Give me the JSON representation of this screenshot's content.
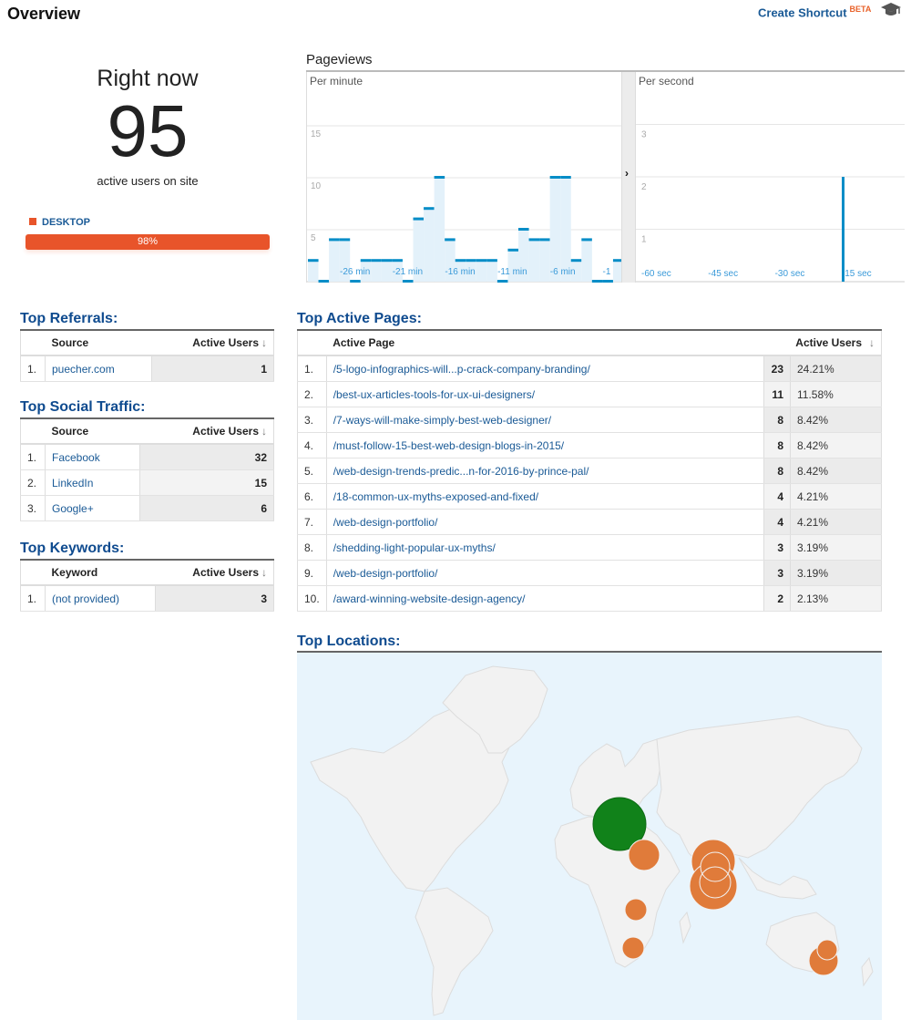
{
  "header": {
    "title": "Overview",
    "shortcut_label": "Create Shortcut",
    "shortcut_badge": "BETA",
    "help_icon": "graduation-cap-icon"
  },
  "right_now": {
    "label": "Right now",
    "active_users": "95",
    "subtitle": "active users on site",
    "device_label": "DESKTOP",
    "device_percent": "98%",
    "device_fraction": 0.98,
    "device_color": "#e8542a"
  },
  "pageviews": {
    "title": "Pageviews",
    "expand_icon": "chevron-right-icon"
  },
  "chart_data": [
    {
      "type": "bar",
      "title": "Per minute",
      "xlabel": "",
      "ylabel": "Pageviews",
      "ylim": [
        0,
        18
      ],
      "yticks": [
        5,
        10,
        15
      ],
      "xtick_labels": [
        "-26 min",
        "-21 min",
        "-16 min",
        "-11 min",
        "-6 min",
        "-1"
      ],
      "categories": [
        "-30",
        "-29",
        "-28",
        "-27",
        "-26",
        "-25",
        "-24",
        "-23",
        "-22",
        "-21",
        "-20",
        "-19",
        "-18",
        "-17",
        "-16",
        "-15",
        "-14",
        "-13",
        "-12",
        "-11",
        "-10",
        "-9",
        "-8",
        "-7",
        "-6",
        "-5",
        "-4",
        "-3",
        "-2",
        "-1"
      ],
      "values": [
        2,
        0,
        4,
        4,
        0,
        2,
        2,
        2,
        2,
        0,
        6,
        7,
        10,
        4,
        2,
        2,
        2,
        2,
        0,
        3,
        5,
        4,
        4,
        10,
        10,
        2,
        4,
        0,
        0,
        2
      ],
      "color": "#058dc7",
      "fill": "#e3f1fa"
    },
    {
      "type": "bar",
      "title": "Per second",
      "xlabel": "",
      "ylabel": "Pageviews",
      "ylim": [
        0,
        4
      ],
      "yticks": [
        1,
        2,
        3
      ],
      "xtick_labels": [
        "-60 sec",
        "-45 sec",
        "-30 sec",
        "-15 sec"
      ],
      "bars": [
        {
          "x": -15,
          "value": 2
        }
      ],
      "color": "#058dc7"
    }
  ],
  "referrals": {
    "title": "Top Referrals:",
    "columns": [
      "Source",
      "Active Users"
    ],
    "rows": [
      {
        "idx": "1.",
        "name": "puecher.com",
        "value": "1"
      }
    ]
  },
  "social": {
    "title": "Top Social Traffic:",
    "columns": [
      "Source",
      "Active Users"
    ],
    "rows": [
      {
        "idx": "1.",
        "name": "Facebook",
        "value": "32"
      },
      {
        "idx": "2.",
        "name": "LinkedIn",
        "value": "15"
      },
      {
        "idx": "3.",
        "name": "Google+",
        "value": "6"
      }
    ]
  },
  "keywords": {
    "title": "Top Keywords:",
    "columns": [
      "Keyword",
      "Active Users"
    ],
    "rows": [
      {
        "idx": "1.",
        "name": "(not provided)",
        "value": "3"
      }
    ]
  },
  "pages": {
    "title": "Top Active Pages:",
    "columns": [
      "Active Page",
      "Active Users"
    ],
    "rows": [
      {
        "idx": "1.",
        "name": "/5-logo-infographics-will...p-crack-company-branding/",
        "value": "23",
        "pct": "24.21%"
      },
      {
        "idx": "2.",
        "name": "/best-ux-articles-tools-for-ux-ui-designers/",
        "value": "11",
        "pct": "11.58%"
      },
      {
        "idx": "3.",
        "name": "/7-ways-will-make-simply-best-web-designer/",
        "value": "8",
        "pct": "8.42%"
      },
      {
        "idx": "4.",
        "name": "/must-follow-15-best-web-design-blogs-in-2015/",
        "value": "8",
        "pct": "8.42%"
      },
      {
        "idx": "5.",
        "name": "/web-design-trends-predic...n-for-2016-by-prince-pal/",
        "value": "8",
        "pct": "8.42%"
      },
      {
        "idx": "6.",
        "name": "/18-common-ux-myths-exposed-and-fixed/",
        "value": "4",
        "pct": "4.21%"
      },
      {
        "idx": "7.",
        "name": "/web-design-portfolio/",
        "value": "4",
        "pct": "4.21%"
      },
      {
        "idx": "8.",
        "name": "/shedding-light-popular-ux-myths/",
        "value": "3",
        "pct": "3.19%"
      },
      {
        "idx": "9.",
        "name": "/web-design-portfolio/",
        "value": "3",
        "pct": "3.19%"
      },
      {
        "idx": "10.",
        "name": "/award-winning-website-design-agency/",
        "value": "2",
        "pct": "2.13%"
      }
    ]
  },
  "locations": {
    "title": "Top Locations:",
    "ocean_color": "#e8f4fc",
    "land_color": "#f2f2f2",
    "markers": [
      {
        "region": "central-europe",
        "color": "#11821a",
        "size": "large"
      },
      {
        "region": "egypt",
        "color": "#e07b3a",
        "size": "small"
      },
      {
        "region": "north-india",
        "color": "#e07b3a",
        "size": "large"
      },
      {
        "region": "central-india",
        "color": "#e07b3a",
        "size": "medium"
      },
      {
        "region": "south-india",
        "color": "#e07b3a",
        "size": "large"
      },
      {
        "region": "tanzania",
        "color": "#e07b3a",
        "size": "small"
      },
      {
        "region": "south-africa",
        "color": "#e07b3a",
        "size": "small"
      },
      {
        "region": "sydney",
        "color": "#e07b3a",
        "size": "small"
      },
      {
        "region": "melbourne",
        "color": "#e07b3a",
        "size": "small"
      }
    ]
  }
}
